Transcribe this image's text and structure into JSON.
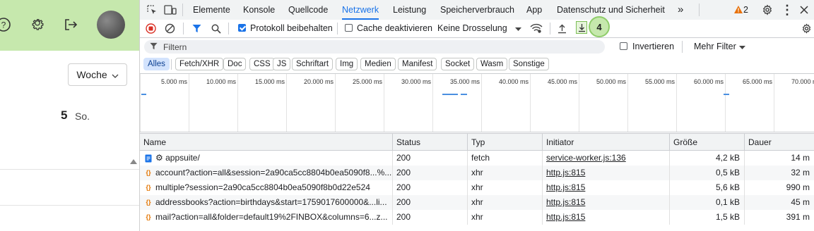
{
  "app": {
    "view_select": "Woche",
    "day_number": "5",
    "day_name": "So."
  },
  "devtools": {
    "tabs": [
      {
        "label": "Elemente"
      },
      {
        "label": "Konsole"
      },
      {
        "label": "Quellcode"
      },
      {
        "label": "Netzwerk",
        "active": true
      },
      {
        "label": "Leistung"
      },
      {
        "label": "Speicherverbrauch"
      },
      {
        "label": "App"
      },
      {
        "label": "Datenschutz und Sicherheit"
      }
    ],
    "more_tabs": "»",
    "warning_count": "2",
    "toolbar": {
      "preserve_log_label": "Protokoll beibehalten",
      "disable_cache_label": "Cache deaktivieren",
      "throttling_value": "Keine Drosselung"
    },
    "step_badge": "4",
    "filter": {
      "placeholder": "Filtern",
      "invert_label": "Invertieren",
      "more_filters": "Mehr Filter"
    },
    "type_chips": [
      "Alles",
      "Fetch/XHR",
      "Doc",
      "CSS",
      "JS",
      "Schriftart",
      "Img",
      "Medien",
      "Manifest",
      "Socket",
      "Wasm",
      "Sonstige"
    ],
    "timeline_ticks": [
      "5.000 ms",
      "10.000 ms",
      "15.000 ms",
      "20.000 ms",
      "25.000 ms",
      "30.000 ms",
      "35.000 ms",
      "40.000 ms",
      "45.000 ms",
      "50.000 ms",
      "55.000 ms",
      "60.000 ms",
      "65.000 ms",
      "70.000 ms"
    ],
    "columns": {
      "name": "Name",
      "status": "Status",
      "type": "Typ",
      "initiator": "Initiator",
      "size": "Größe",
      "time": "Dauer"
    },
    "requests": [
      {
        "name": "⚙ appsuite/",
        "status": "200",
        "type": "fetch",
        "initiator": "service-worker.js:136",
        "size": "4,2 kB",
        "time": "14 m"
      },
      {
        "name": "account?action=all&session=2a90ca5cc8804b0ea5090f8...%...",
        "status": "200",
        "type": "xhr",
        "initiator": "http.js:815",
        "size": "0,5 kB",
        "time": "32 m"
      },
      {
        "name": "multiple?session=2a90ca5cc8804b0ea5090f8b0d22e524",
        "status": "200",
        "type": "xhr",
        "initiator": "http.js:815",
        "size": "5,6 kB",
        "time": "990 m"
      },
      {
        "name": "addressbooks?action=birthdays&start=1759017600000&...li...",
        "status": "200",
        "type": "xhr",
        "initiator": "http.js:815",
        "size": "0,1 kB",
        "time": "45 m"
      },
      {
        "name": "mail?action=all&folder=default19%2FINBOX&columns=6...z...",
        "status": "200",
        "type": "xhr",
        "initiator": "http.js:815",
        "size": "1,5 kB",
        "time": "391 m"
      }
    ]
  }
}
